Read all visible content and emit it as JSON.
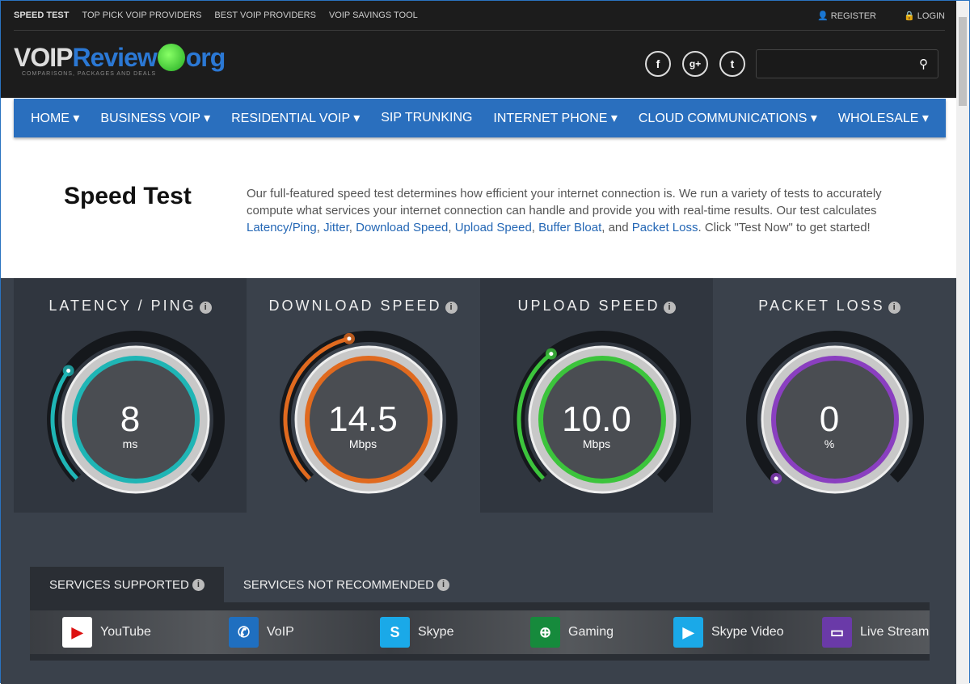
{
  "toplinks": [
    "SPEED TEST",
    "TOP PICK VOIP PROVIDERS",
    "BEST VOIP PROVIDERS",
    "VOIP SAVINGS TOOL"
  ],
  "account": {
    "register": "REGISTER",
    "login": "LOGIN"
  },
  "logo": {
    "part1": "VOIP",
    "part2": "Review",
    "part3": "org",
    "tagline": "COMPARISONS, PACKAGES AND DEALS"
  },
  "social": [
    "f",
    "g+",
    "t"
  ],
  "search": {
    "value": "",
    "placeholder": ""
  },
  "nav": [
    "HOME ▾",
    "BUSINESS VOIP ▾",
    "RESIDENTIAL VOIP ▾",
    "SIP TRUNKING",
    "INTERNET PHONE ▾",
    "CLOUD COMMUNICATIONS ▾",
    "WHOLESALE ▾"
  ],
  "title": "Speed Test",
  "intro": {
    "text1": "Our full-featured speed test determines how efficient your internet connection is. We run a variety of tests to accurately compute what services your internet connection can handle and provide you with real-time results. Our test calculates ",
    "links": [
      "Latency/Ping",
      "Jitter",
      "Download Speed",
      "Upload Speed",
      "Buffer Bloat",
      "Packet Loss"
    ],
    "text2": " Click \"Test Now\" to get started!"
  },
  "gauges": [
    {
      "label": "LATENCY / PING",
      "value": "8",
      "unit": "ms",
      "level": 0.3,
      "color": "#1fb5b5"
    },
    {
      "label": "DOWNLOAD SPEED",
      "value": "14.5",
      "unit": "Mbps",
      "level": 0.45,
      "color": "#e06a1f"
    },
    {
      "label": "UPLOAD SPEED",
      "value": "10.0",
      "unit": "Mbps",
      "level": 0.36,
      "color": "#3cc43c"
    },
    {
      "label": "PACKET LOSS",
      "value": "0",
      "unit": "%",
      "level": 0,
      "color": "#8a3fc0"
    }
  ],
  "tabs": [
    "SERVICES SUPPORTED",
    "SERVICES NOT RECOMMENDED"
  ],
  "services": [
    {
      "name": "YouTube",
      "icon": "youtube-icon",
      "color": "#ffffff"
    },
    {
      "name": "VoIP",
      "icon": "phone-icon",
      "color": "#1f6fc0"
    },
    {
      "name": "Skype",
      "icon": "skype-icon",
      "color": "#1aa9e8"
    },
    {
      "name": "Gaming",
      "icon": "gamepad-icon",
      "color": "#168a3c"
    },
    {
      "name": "Skype Video",
      "icon": "video-chat-icon",
      "color": "#1aa9e8"
    },
    {
      "name": "Live Streami",
      "icon": "monitor-icon",
      "color": "#6a3aa8"
    }
  ]
}
